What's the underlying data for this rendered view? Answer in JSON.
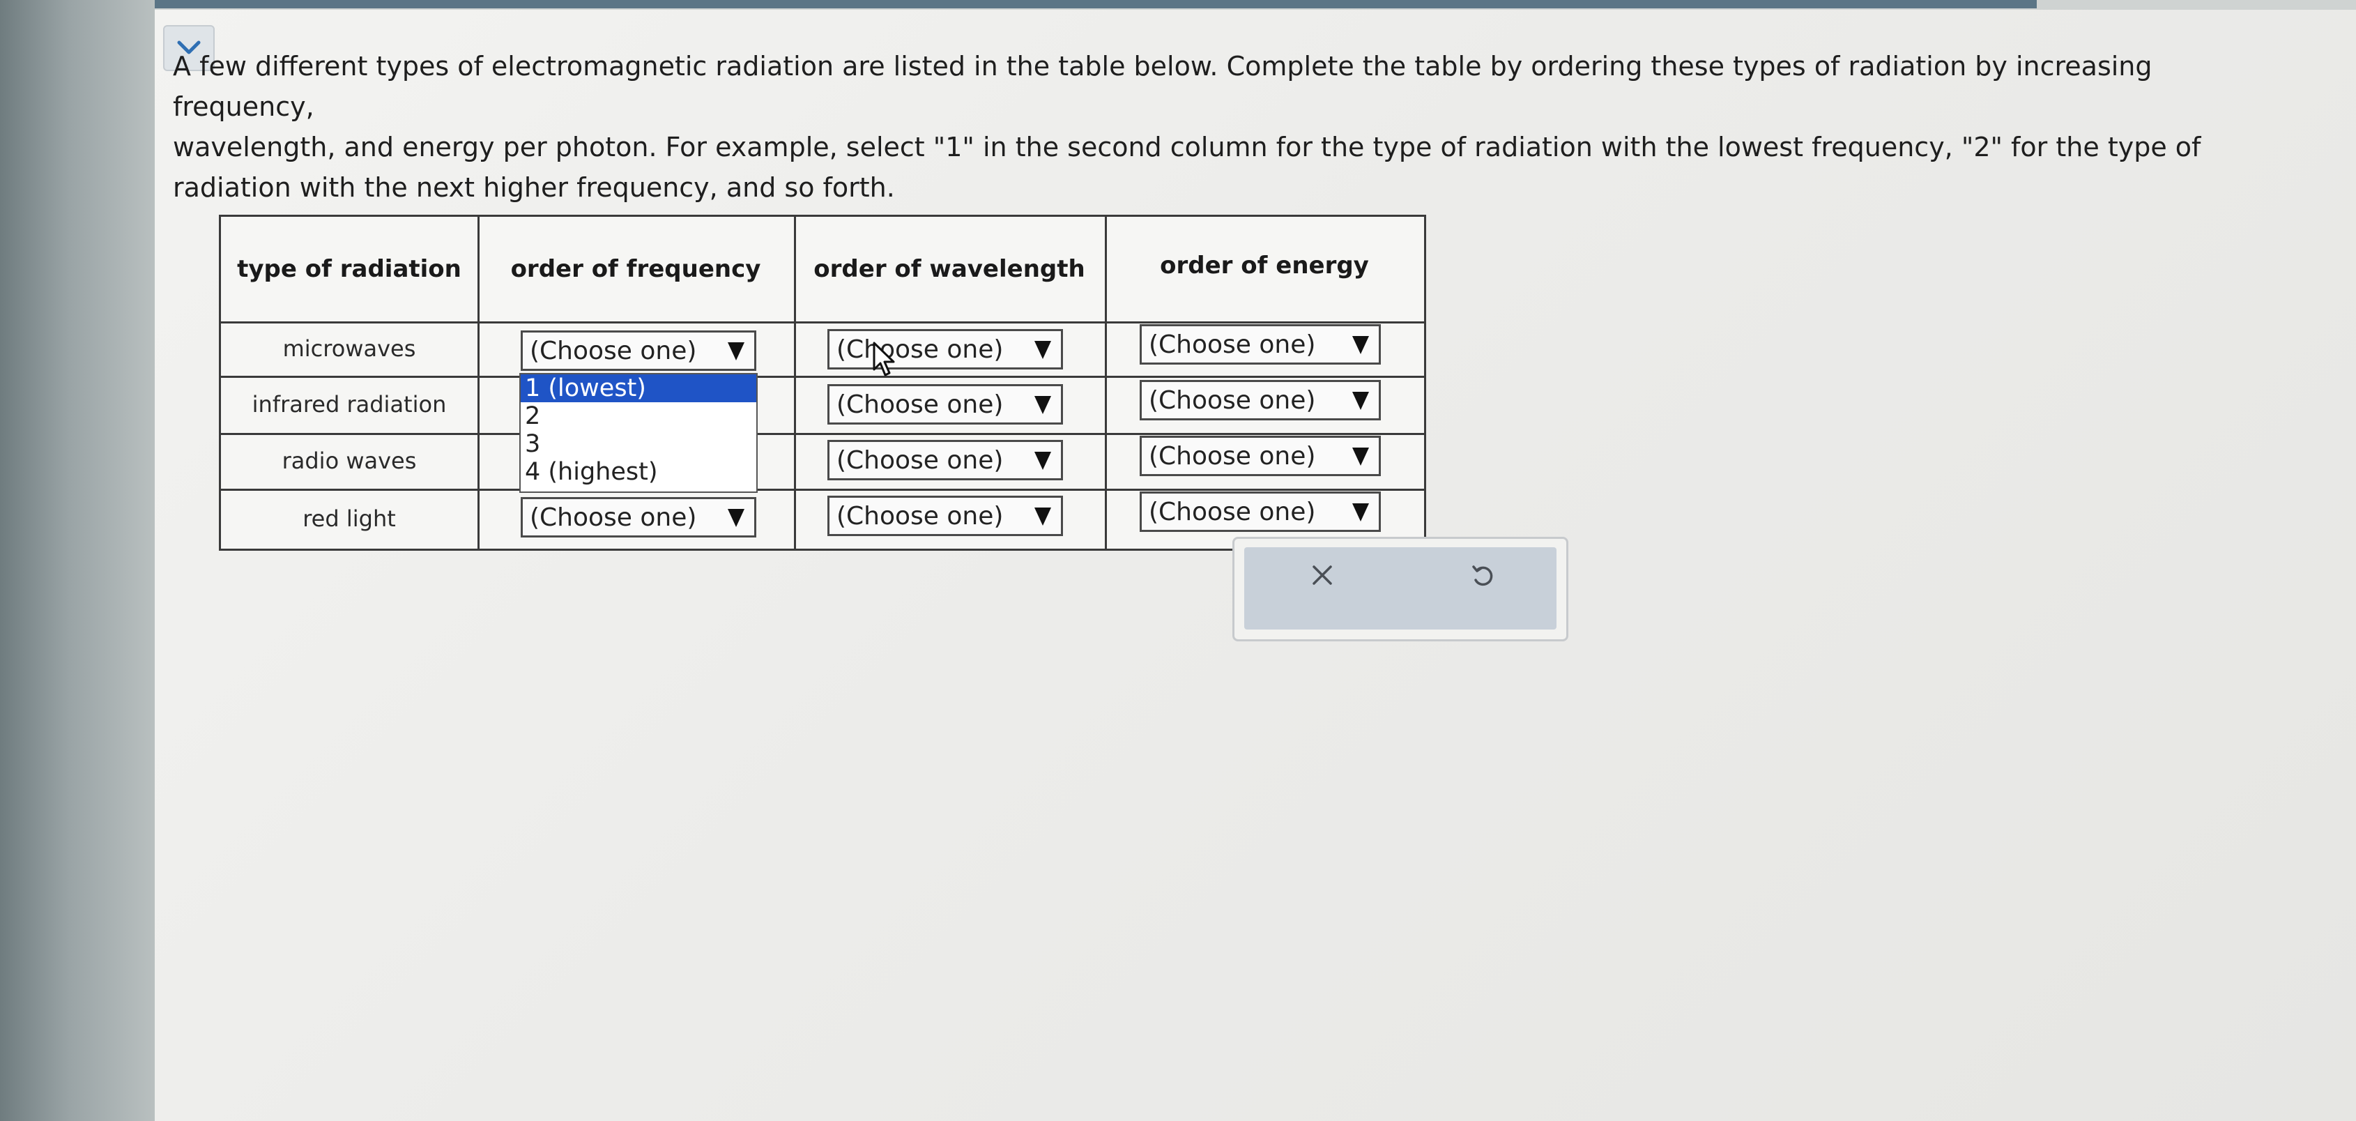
{
  "instructions": {
    "line1": "A few different types of electromagnetic radiation are listed in the table below. Complete the table by ordering these types of radiation by increasing frequency,",
    "line2": "wavelength, and energy per photon. For example, select \"1\" in the second column for the type of radiation with the lowest frequency, \"2\" for the type of",
    "line3": "radiation with the next higher frequency, and so forth."
  },
  "table": {
    "headers": [
      "type of radiation",
      "order of frequency",
      "order of wavelength",
      "order of energy"
    ],
    "rows": [
      {
        "label": "microwaves",
        "frequency": "(Choose one)",
        "wavelength": "(Choose one)",
        "energy": "(Choose one)"
      },
      {
        "label": "infrared radiation",
        "frequency": "",
        "wavelength": "(Choose one)",
        "energy": "(Choose one)"
      },
      {
        "label": "radio waves",
        "frequency": "",
        "wavelength": "(Choose one)",
        "energy": "(Choose one)"
      },
      {
        "label": "red light",
        "frequency": "(Choose one)",
        "wavelength": "(Choose one)",
        "energy": "(Choose one)"
      }
    ]
  },
  "dropdown": {
    "options": [
      "1 (lowest)",
      "2",
      "3",
      "4 (highest)"
    ],
    "highlighted": "1 (lowest)",
    "highlight_color": "#1f54c6"
  },
  "actions": {
    "clear_icon": "close-icon",
    "undo_icon": "undo-icon",
    "bar_color": "#c8d0d9"
  }
}
